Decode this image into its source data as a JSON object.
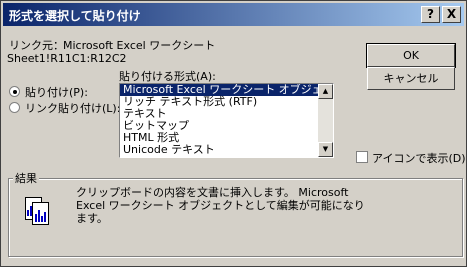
{
  "title": "形式を選択して貼り付け",
  "titlebar": {
    "help_glyph": "?",
    "close_glyph": "X"
  },
  "source": {
    "label": "リンク元：",
    "app": "Microsoft Excel ワークシート",
    "range": "Sheet1!R11C1:R12C2"
  },
  "paste_as_label": "貼り付ける形式(A):",
  "paste_as_label_underline": "A",
  "radios": [
    {
      "label": "貼り付け(P):",
      "selected": true
    },
    {
      "label": "リンク貼り付け(L):",
      "selected": false
    }
  ],
  "formats": [
    "Microsoft Excel ワークシート オブジェクト",
    "リッチ テキスト形式 (RTF)",
    "テキスト",
    "ビットマップ",
    "HTML 形式",
    "Unicode テキスト"
  ],
  "selected_format_index": 0,
  "buttons": {
    "ok": "OK",
    "cancel": "キャンセル"
  },
  "display_as_icon": {
    "label": "アイコンで表示(D)",
    "checked": false
  },
  "result": {
    "title": "結果",
    "text_line1": "クリップボードの内容を文書に挿入します。 Microsoft",
    "text_line2": "Excel ワークシート オブジェクトとして編集が可能になり",
    "text_line3": "ます。"
  }
}
